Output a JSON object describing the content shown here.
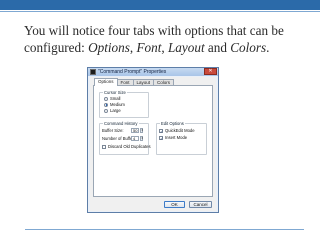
{
  "heading": {
    "lead": "You will notice four tabs with options that can be configured: ",
    "t1": "Options",
    "sep1": ", ",
    "t2": "Font",
    "sep2": ", ",
    "t3": "Layout",
    "sep3": " and ",
    "t4": "Colors",
    "tail": "."
  },
  "dialog": {
    "title": "\"Command Prompt\" Properties",
    "close_label": "✕",
    "tabs": [
      "Options",
      "Font",
      "Layout",
      "Colors"
    ],
    "active_tab": "Options",
    "cursor_size": {
      "title": "Cursor Size",
      "options": [
        "Small",
        "Medium",
        "Large"
      ],
      "selected": "Medium"
    },
    "command_history": {
      "title": "Command History",
      "buffer_size_label": "Buffer Size:",
      "buffer_size_value": "50",
      "num_buffers_label": "Number of Buffers:",
      "num_buffers_value": "4",
      "discard_label": "Discard Old Duplicates",
      "discard_checked": false
    },
    "edit_options": {
      "title": "Edit Options",
      "quickedit_label": "QuickEdit Mode",
      "quickedit_checked": true,
      "insert_label": "Insert Mode",
      "insert_checked": true
    },
    "ok_label": "OK",
    "cancel_label": "Cancel"
  },
  "colors": {
    "top_bar": "#2b6aa9",
    "accent_line": "#7fa8d2"
  }
}
